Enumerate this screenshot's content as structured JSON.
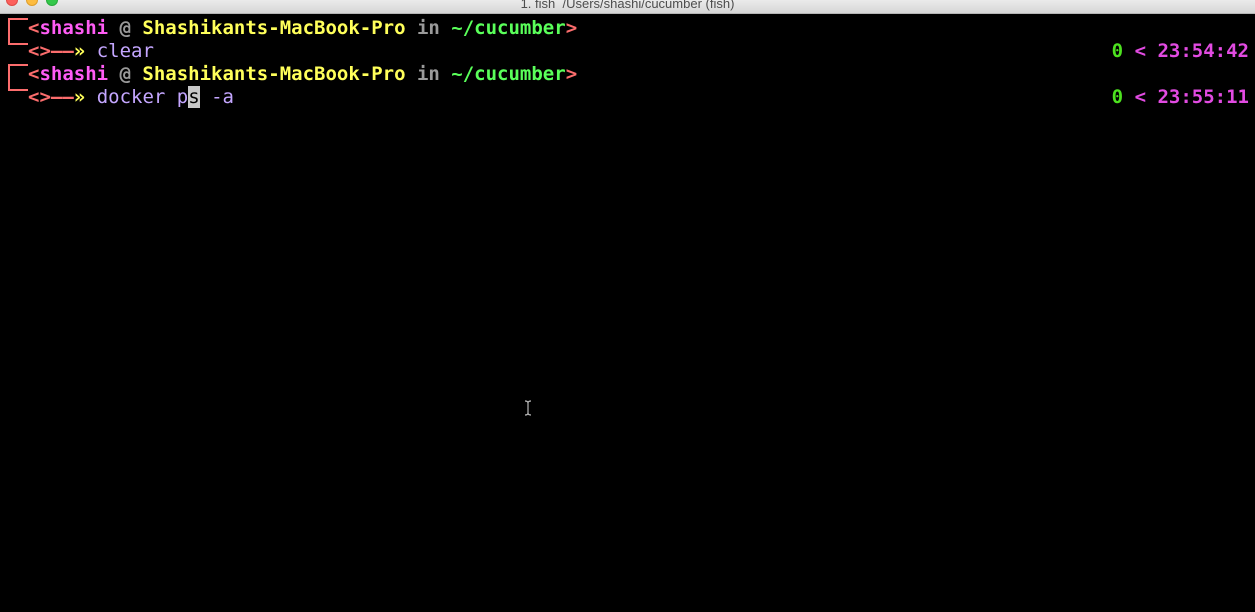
{
  "window": {
    "title": "1. fish  /Users/shashi/cucumber (fish)"
  },
  "prompt": {
    "open_bracket": "<",
    "user": "shashi",
    "at": " @ ",
    "host": "Shashikants-MacBook-Pro",
    "in": " in ",
    "path": "~/cucumber",
    "close_bracket": ">",
    "arrow_prefix": "<>",
    "arrow_line": "——",
    "arrow_mark": "»"
  },
  "history": [
    {
      "command": "clear",
      "status": "0",
      "separator": "<",
      "time": "23:54:42"
    },
    {
      "command_before_cursor": "docker p",
      "cursor_char": "s",
      "command_after_cursor": " -a",
      "status": "0",
      "separator": "<",
      "time": "23:55:11"
    }
  ],
  "colors": {
    "background": "#000000",
    "bracket": "#fc6d6d",
    "user": "#ff5cf5",
    "host": "#ffff5a",
    "path": "#5aff5a",
    "command": "#c4a6ff",
    "status": "#4de21f",
    "time": "#e24be2"
  }
}
